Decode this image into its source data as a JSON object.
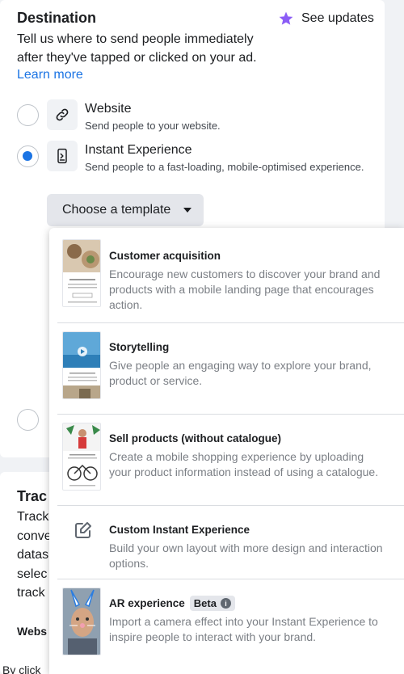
{
  "destination": {
    "title": "Destination",
    "see_updates": "See updates",
    "description": "Tell us where to send people immediately after they've tapped or clicked on your ad.",
    "learn_more": "Learn more",
    "options": [
      {
        "title": "Website",
        "subtitle": "Send people to your website.",
        "icon": "link-icon",
        "selected": false
      },
      {
        "title": "Instant Experience",
        "subtitle": "Send people to a fast-loading, mobile-optimised experience.",
        "icon": "instant-experience-icon",
        "selected": true
      }
    ],
    "template_button": "Choose a template"
  },
  "templates": [
    {
      "title": "Customer acquisition",
      "description": "Encourage new customers to discover your brand and products with a mobile landing page that encourages action."
    },
    {
      "title": "Storytelling",
      "description": "Give people an engaging way to explore your brand, product or service."
    },
    {
      "title": "Sell products (without catalogue)",
      "description": "Create a mobile shopping experience by uploading your product information instead of using a catalogue."
    },
    {
      "title": "Custom Instant Experience",
      "description": "Build your own layout with more design and interaction options.",
      "icon": "edit-icon"
    },
    {
      "title": "AR experience",
      "badge": "Beta",
      "description": "Import a camera effect into your Instant Experience to inspire people to interact with your brand."
    }
  ],
  "tracking": {
    "title": "Trac",
    "lines": [
      "Track",
      "conve",
      "datas",
      "selec",
      "track"
    ],
    "website_label": "Webs"
  },
  "bottom_note": "By click",
  "colors": {
    "accent": "#1b74e4",
    "star": "#8b5cf6",
    "muted": "#7b7f85"
  }
}
